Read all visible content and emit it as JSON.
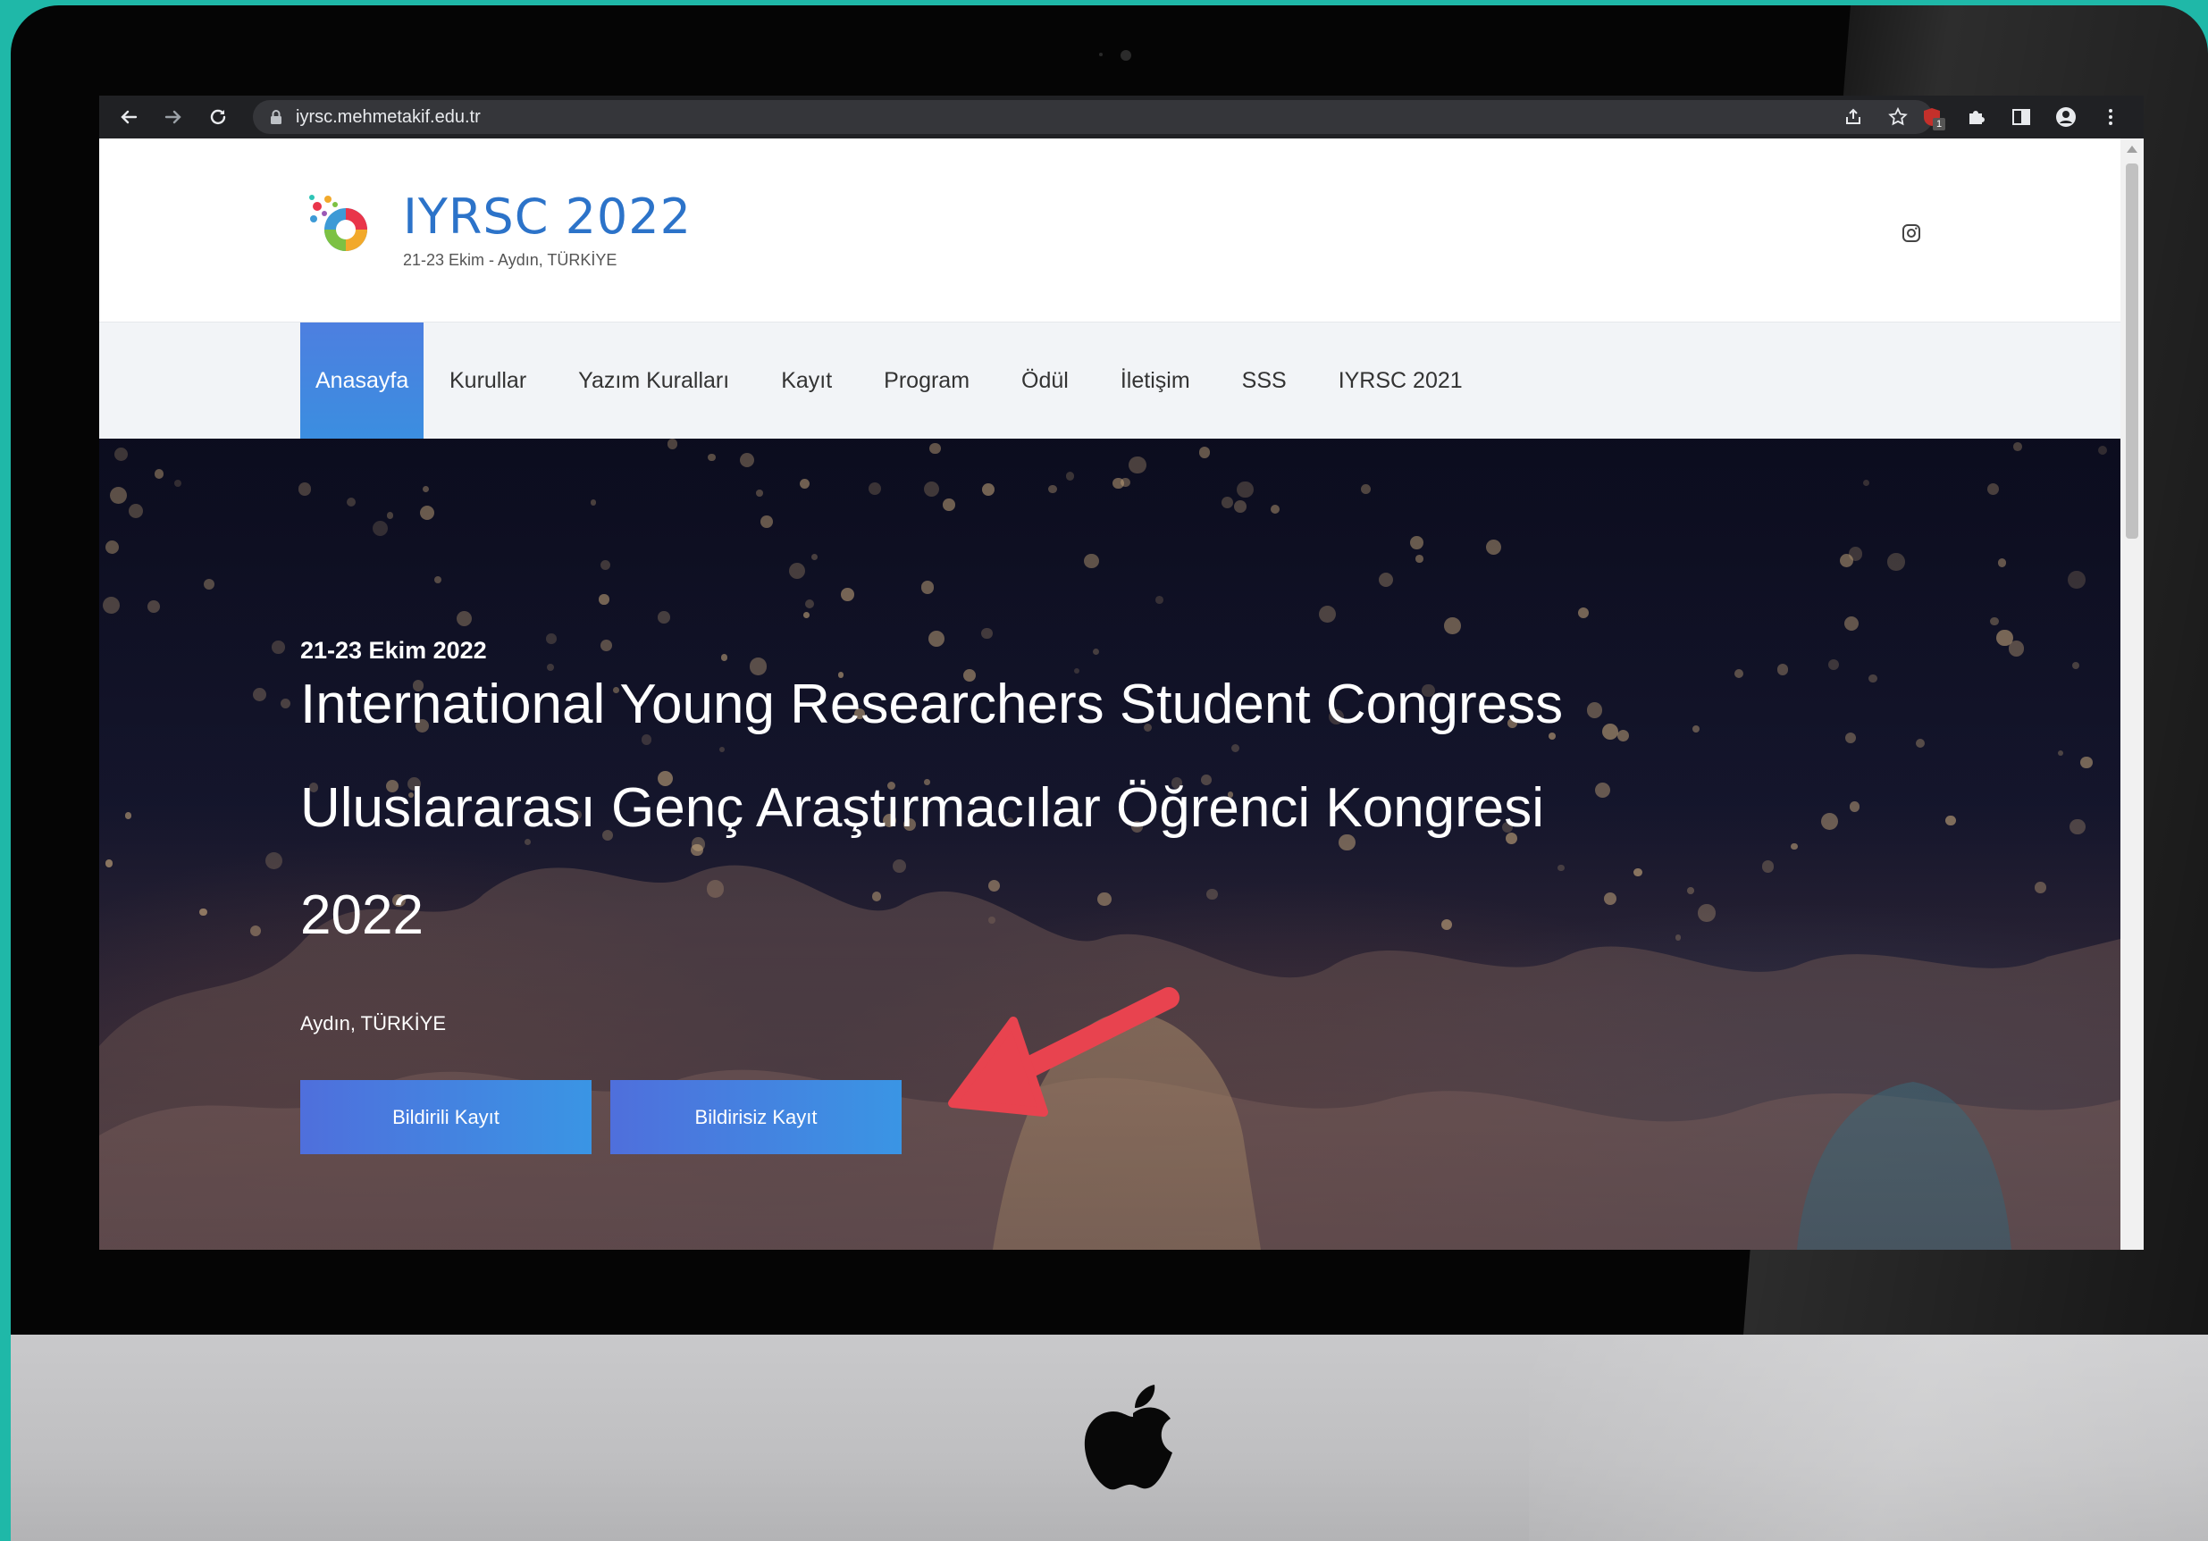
{
  "browser": {
    "url": "iyrsc.mehmetakif.edu.tr",
    "extension_badge": "1"
  },
  "site": {
    "title": "IYRSC 2022",
    "subtitle": "21-23 Ekim - Aydın, TÜRKİYE"
  },
  "nav": {
    "items": [
      {
        "label": "Anasayfa",
        "active": true
      },
      {
        "label": "Kurullar"
      },
      {
        "label": "Yazım Kuralları"
      },
      {
        "label": "Kayıt"
      },
      {
        "label": "Program"
      },
      {
        "label": "Ödül"
      },
      {
        "label": "İletişim"
      },
      {
        "label": "SSS"
      },
      {
        "label": "IYRSC 2021"
      }
    ]
  },
  "hero": {
    "date": "21-23 Ekim 2022",
    "title_line1": "International Young Researchers Student Congress",
    "title_line2": "Uluslararası Genç Araştırmacılar Öğrenci Kongresi",
    "title_line3": "2022",
    "location": "Aydın, TÜRKİYE",
    "buttons": {
      "with_paper": "Bildirili Kayıt",
      "without_paper": "Bildirisiz Kayıt"
    }
  },
  "colors": {
    "brand_blue": "#2c73c9",
    "button_gradient_start": "#4f6fdc",
    "button_gradient_end": "#3a95e4",
    "annotation_arrow": "#e8434f",
    "backdrop_teal": "#1fb8a8"
  }
}
